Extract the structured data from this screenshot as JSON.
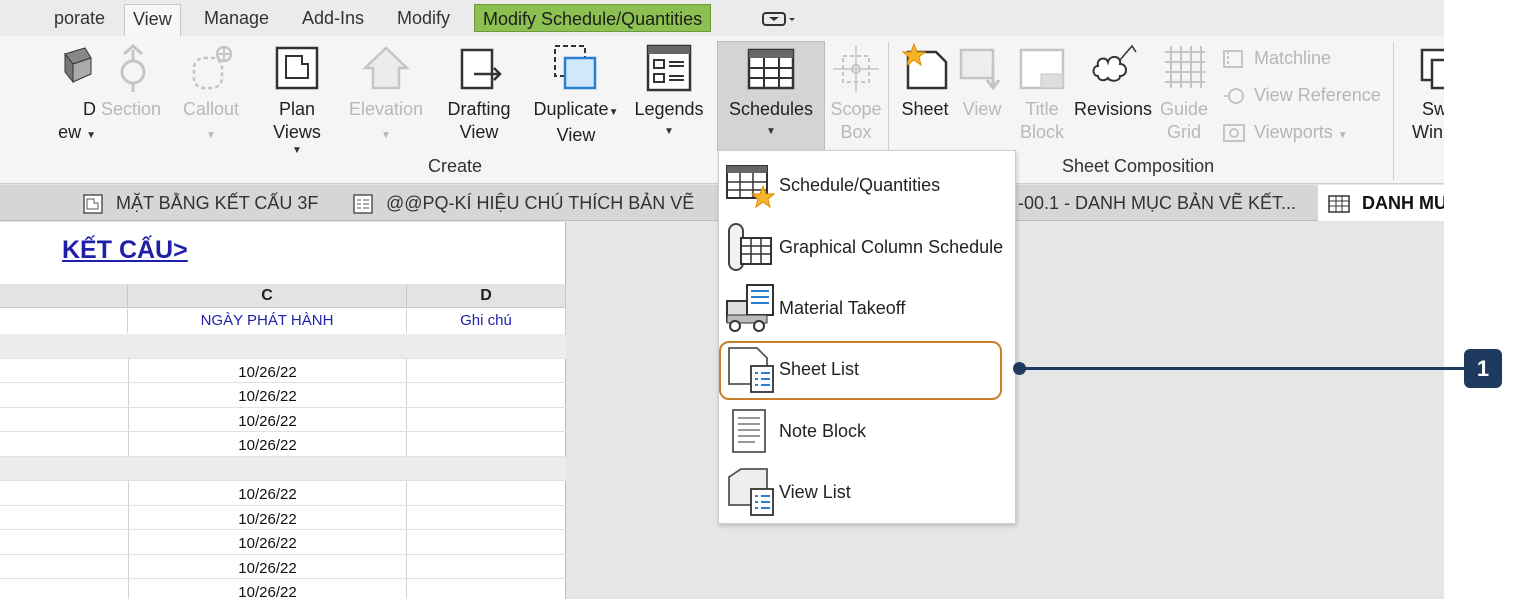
{
  "ribbon_tabs": {
    "collaborate": "porate",
    "view": "View",
    "manage": "Manage",
    "addins": "Add-Ins",
    "modify": "Modify",
    "context": "Modify Schedule/Quantities"
  },
  "tools": {
    "d3_line1": "D",
    "d3_line2": "ew",
    "section": "Section",
    "callout": "Callout",
    "plan_line1": "Plan",
    "plan_line2": "Views",
    "elevation": "Elevation",
    "drafting_line1": "Drafting",
    "drafting_line2": "View",
    "duplicate_line1": "Duplicate",
    "duplicate_line2": "View",
    "legends": "Legends",
    "schedules": "Schedules",
    "scope_line1": "Scope",
    "scope_line2": "Box",
    "sheet": "Sheet",
    "view": "View",
    "title_line1": "Title",
    "title_line2": "Block",
    "revisions": "Revisions",
    "guide_line1": "Guide",
    "guide_line2": "Grid",
    "matchline": "Matchline",
    "view_reference": "View  Reference",
    "viewports": "Viewports",
    "switch_line1": "Sw",
    "switch_line2": "Win"
  },
  "panels": {
    "create": "Create",
    "sheet_composition": "Sheet Composition"
  },
  "view_tabs": [
    "MẶT BẰNG KẾT CẤU 3F",
    "@@PQ-KÍ HIỆU CHÚ THÍCH BẢN VẼ",
    "-00.1 - DANH MỤC BẢN VẼ KẾT...",
    "DANH MU"
  ],
  "schedule": {
    "title": "KẾT CẤU>",
    "col_c": "C",
    "col_d": "D",
    "head_c": "NGÀY PHÁT HÀNH",
    "head_d": "Ghi chú",
    "rows": [
      "",
      "10/26/22",
      "10/26/22",
      "10/26/22",
      "10/26/22",
      "",
      "10/26/22",
      "10/26/22",
      "10/26/22",
      "10/26/22",
      "10/26/22"
    ]
  },
  "dropdown": {
    "items": [
      "Schedule/Quantities",
      "Graphical Column Schedule",
      "Material Takeoff",
      "Sheet List",
      "Note Block",
      "View List"
    ]
  },
  "callout": {
    "number": "1"
  },
  "colors": {
    "context_tab": "#8cc152",
    "highlight": "#c8812a",
    "callout": "#1e3a5f",
    "schedule_text": "#1f1fa8"
  }
}
